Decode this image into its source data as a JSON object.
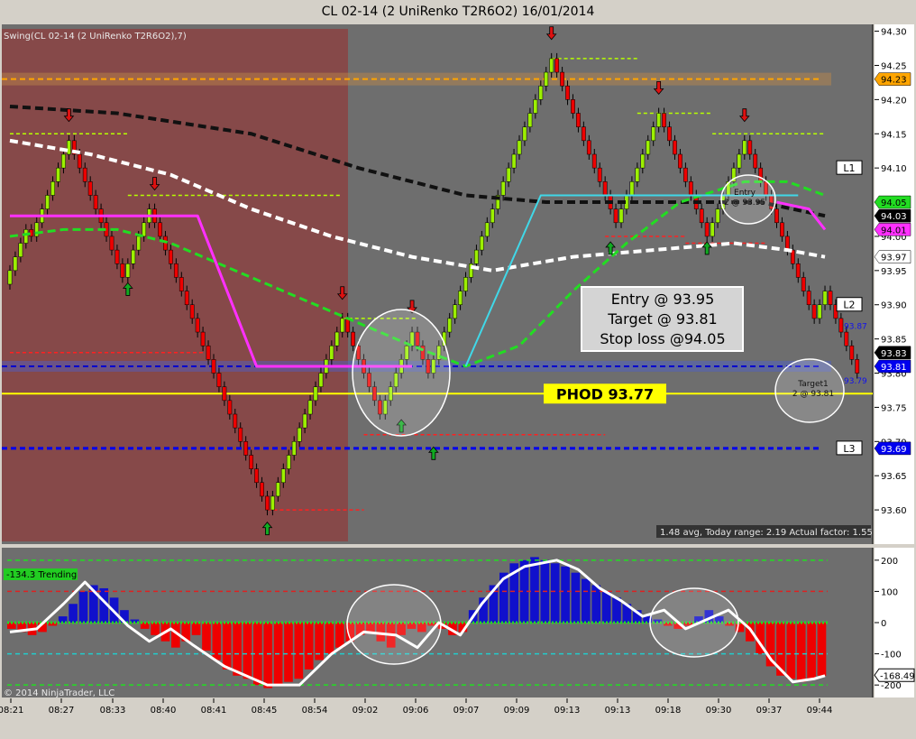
{
  "window": {
    "title": "CL 02-14 (2 UniRenko T2R6O2)  16/01/2014"
  },
  "colors": {
    "background": "#6e6e6e",
    "shaded_region": "#8b4343",
    "bull_bar": "#9cf000",
    "bear_bar": "#ee0000",
    "phod_line": "#ffff00",
    "bid_price": "#0000ff",
    "hist_positive": "#1010cc",
    "hist_negative": "#ee0000"
  },
  "chart_data": [
    {
      "type": "candlestick",
      "name": "price",
      "indicator_label": "Swing(CL 02-14 (2 UniRenko T2R6O2),7)",
      "ylim": [
        93.55,
        94.31
      ],
      "y_ticks": [
        "94.30",
        "94.25",
        "94.20",
        "94.15",
        "94.10",
        "94.05",
        "94.00",
        "93.95",
        "93.90",
        "93.85",
        "93.80",
        "93.75",
        "93.70",
        "93.65",
        "93.60"
      ],
      "x_ticks": [
        "08:21",
        "08:27",
        "08:33",
        "08:40",
        "08:41",
        "08:45",
        "08:54",
        "09:02",
        "09:06",
        "09:07",
        "09:09",
        "09:13",
        "09:13",
        "09:18",
        "09:30",
        "09:37",
        "09:44"
      ],
      "bars_closes": [
        93.95,
        93.97,
        93.99,
        94.01,
        94.0,
        94.02,
        94.04,
        94.06,
        94.08,
        94.1,
        94.12,
        94.14,
        94.12,
        94.1,
        94.08,
        94.06,
        94.04,
        94.02,
        94.0,
        93.98,
        93.96,
        93.94,
        93.96,
        93.98,
        94.0,
        94.02,
        94.04,
        94.02,
        94.0,
        93.98,
        93.96,
        93.94,
        93.92,
        93.9,
        93.88,
        93.86,
        93.84,
        93.82,
        93.8,
        93.78,
        93.76,
        93.74,
        93.72,
        93.7,
        93.68,
        93.66,
        93.64,
        93.62,
        93.6,
        93.62,
        93.64,
        93.66,
        93.68,
        93.7,
        93.72,
        93.74,
        93.76,
        93.78,
        93.8,
        93.82,
        93.84,
        93.86,
        93.88,
        93.86,
        93.84,
        93.82,
        93.8,
        93.78,
        93.76,
        93.74,
        93.76,
        93.78,
        93.8,
        93.82,
        93.84,
        93.86,
        93.84,
        93.82,
        93.8,
        93.82,
        93.84,
        93.86,
        93.88,
        93.9,
        93.92,
        93.94,
        93.96,
        93.98,
        94.0,
        94.02,
        94.04,
        94.06,
        94.08,
        94.1,
        94.12,
        94.14,
        94.16,
        94.18,
        94.2,
        94.22,
        94.24,
        94.26,
        94.24,
        94.22,
        94.2,
        94.18,
        94.16,
        94.14,
        94.12,
        94.1,
        94.08,
        94.06,
        94.04,
        94.02,
        94.04,
        94.06,
        94.08,
        94.1,
        94.12,
        94.14,
        94.16,
        94.18,
        94.16,
        94.14,
        94.12,
        94.1,
        94.08,
        94.06,
        94.04,
        94.02,
        94.0,
        94.02,
        94.04,
        94.06,
        94.08,
        94.1,
        94.12,
        94.14,
        94.12,
        94.1,
        94.08,
        94.06,
        94.04,
        94.02,
        94.0,
        93.98,
        93.96,
        93.94,
        93.92,
        93.9,
        93.88,
        93.9,
        93.92,
        93.9,
        93.88,
        93.86,
        93.84,
        93.82,
        93.8
      ],
      "box_size": 0.02,
      "swing_high_arrows": [
        {
          "bar": 11,
          "price": 94.16
        },
        {
          "bar": 27,
          "price": 94.06
        },
        {
          "bar": 62,
          "price": 93.9
        },
        {
          "bar": 75,
          "price": 93.88
        },
        {
          "bar": 101,
          "price": 94.28
        },
        {
          "bar": 121,
          "price": 94.2
        },
        {
          "bar": 137,
          "price": 94.16
        }
      ],
      "swing_low_arrows": [
        {
          "bar": 22,
          "price": 93.94
        },
        {
          "bar": 48,
          "price": 93.59
        },
        {
          "bar": 73,
          "price": 93.74
        },
        {
          "bar": 79,
          "price": 93.7
        },
        {
          "bar": 112,
          "price": 94.0
        },
        {
          "bar": 130,
          "price": 94.0
        }
      ],
      "dashed_levels": [
        {
          "price": 94.15,
          "from_bar": 0,
          "to_bar": 22,
          "color": "#b6ff00"
        },
        {
          "price": 94.06,
          "from_bar": 22,
          "to_bar": 62,
          "color": "#b6ff00"
        },
        {
          "price": 93.88,
          "from_bar": 62,
          "to_bar": 76,
          "color": "#b6ff00"
        },
        {
          "price": 94.26,
          "from_bar": 101,
          "to_bar": 117,
          "color": "#b6ff00"
        },
        {
          "price": 94.18,
          "from_bar": 117,
          "to_bar": 131,
          "color": "#b6ff00"
        },
        {
          "price": 94.15,
          "from_bar": 131,
          "to_bar": 152,
          "color": "#b6ff00"
        },
        {
          "price": 93.83,
          "from_bar": 0,
          "to_bar": 36,
          "color": "#ff2020"
        },
        {
          "price": 93.6,
          "from_bar": 48,
          "to_bar": 66,
          "color": "#ff2020"
        },
        {
          "price": 93.71,
          "from_bar": 66,
          "to_bar": 111,
          "color": "#ff2020"
        },
        {
          "price": 94.0,
          "from_bar": 111,
          "to_bar": 126,
          "color": "#ff2020"
        },
        {
          "price": 93.99,
          "from_bar": 126,
          "to_bar": 141,
          "color": "#ff2020"
        }
      ],
      "moving_averages": [
        {
          "color": "#111111",
          "style": "dash",
          "width": 4,
          "values": [
            [
              0,
              94.19
            ],
            [
              20,
              94.18
            ],
            [
              45,
              94.15
            ],
            [
              65,
              94.1
            ],
            [
              85,
              94.06
            ],
            [
              100,
              94.05
            ],
            [
              120,
              94.05
            ],
            [
              140,
              94.05
            ],
            [
              152,
              94.03
            ]
          ]
        },
        {
          "color": "#ffffff",
          "style": "dash",
          "width": 4,
          "values": [
            [
              0,
              94.14
            ],
            [
              15,
              94.12
            ],
            [
              30,
              94.09
            ],
            [
              45,
              94.04
            ],
            [
              60,
              94.0
            ],
            [
              75,
              93.97
            ],
            [
              90,
              93.95
            ],
            [
              105,
              93.97
            ],
            [
              120,
              93.98
            ],
            [
              135,
              93.99
            ],
            [
              145,
              93.98
            ],
            [
              152,
              93.97
            ]
          ]
        },
        {
          "color": "#22dd22",
          "style": "dash",
          "width": 3,
          "values": [
            [
              0,
              94.0
            ],
            [
              10,
              94.01
            ],
            [
              20,
              94.01
            ],
            [
              30,
              93.99
            ],
            [
              45,
              93.94
            ],
            [
              60,
              93.89
            ],
            [
              75,
              93.84
            ],
            [
              85,
              93.81
            ],
            [
              95,
              93.84
            ],
            [
              105,
              93.92
            ],
            [
              115,
              93.99
            ],
            [
              125,
              94.05
            ],
            [
              137,
              94.08
            ],
            [
              145,
              94.08
            ],
            [
              152,
              94.06
            ]
          ]
        },
        {
          "color": "#ff30ff",
          "style": "solid",
          "width": 3,
          "values": [
            [
              0,
              94.03
            ],
            [
              35,
              94.03
            ],
            [
              46,
              93.81
            ],
            [
              60,
              93.81
            ],
            [
              75,
              93.81
            ]
          ]
        },
        {
          "color": "#ff30ff",
          "style": "solid",
          "width": 3,
          "values": [
            [
              143,
              94.05
            ],
            [
              149,
              94.04
            ],
            [
              152,
              94.01
            ]
          ]
        },
        {
          "color": "#40d8e8",
          "style": "solid",
          "width": 2,
          "values": [
            [
              85,
              93.81
            ],
            [
              99,
              94.06
            ],
            [
              147,
              94.06
            ]
          ]
        }
      ],
      "horizontal_lines": [
        {
          "label": "PHOD  93.77",
          "price": 93.77,
          "color": "#ffff00",
          "style": "solid"
        },
        {
          "price": 93.69,
          "color": "#0000ee",
          "style": "dash"
        },
        {
          "price": 94.23,
          "color": "#ffa500",
          "style": "dash"
        },
        {
          "price": 93.81,
          "color": "#0000cc",
          "style": "dash"
        }
      ],
      "level_labels": [
        {
          "label": "L1",
          "price": 94.1
        },
        {
          "label": "L2",
          "price": 93.9
        },
        {
          "label": "L3",
          "price": 93.69
        }
      ],
      "price_markers": [
        {
          "text": "94.23",
          "price": 94.23,
          "bg": "#ffa500",
          "fg": "#000000"
        },
        {
          "text": "94.05",
          "price": 94.05,
          "bg": "#22dd22",
          "fg": "#000000"
        },
        {
          "text": "94.03",
          "price": 94.03,
          "bg": "#000000",
          "fg": "#ffffff"
        },
        {
          "text": "94.01",
          "price": 94.01,
          "bg": "#ff30ff",
          "fg": "#000000"
        },
        {
          "text": "93.97",
          "price": 93.97,
          "bg": "#ffffff",
          "fg": "#000000"
        },
        {
          "text": "93.83",
          "price": 93.83,
          "bg": "#000000",
          "fg": "#ffffff"
        },
        {
          "text": "93.81",
          "price": 93.81,
          "bg": "#0000ee",
          "fg": "#ffffff"
        },
        {
          "text": "93.69",
          "price": 93.69,
          "bg": "#0000ee",
          "fg": "#ffffff"
        }
      ],
      "annotations": {
        "trade_box": [
          "Entry @ 93.95",
          "Target @ 93.81",
          "Stop loss @94.05"
        ],
        "entry_marker": [
          "Entry",
          "2 @ 93.95"
        ],
        "target_marker": [
          "Target1",
          "2 @ 93.81"
        ],
        "level_93_87": "93.87",
        "level_93_79": "93.79",
        "status_text": "1.48 avg, Today range: 2.19  Actual factor: 1.55"
      }
    },
    {
      "type": "oscillator",
      "name": "cci",
      "label": "-134.3 Trending",
      "ylim": [
        -240,
        240
      ],
      "y_ticks": [
        "200",
        "100",
        "0",
        "-100",
        "-200"
      ],
      "last_value": "-168.49",
      "levels": [
        {
          "value": 200,
          "color": "#22dd22"
        },
        {
          "value": 100,
          "color": "#dd2222"
        },
        {
          "value": -100,
          "color": "#22cccc"
        },
        {
          "value": -200,
          "color": "#22dd22"
        }
      ],
      "line": [
        [
          0,
          -30
        ],
        [
          5,
          -20
        ],
        [
          10,
          60
        ],
        [
          14,
          130
        ],
        [
          18,
          60
        ],
        [
          22,
          -10
        ],
        [
          26,
          -60
        ],
        [
          30,
          -20
        ],
        [
          34,
          -70
        ],
        [
          40,
          -140
        ],
        [
          48,
          -200
        ],
        [
          54,
          -200
        ],
        [
          60,
          -100
        ],
        [
          66,
          -30
        ],
        [
          72,
          -40
        ],
        [
          76,
          -80
        ],
        [
          80,
          0
        ],
        [
          84,
          -40
        ],
        [
          88,
          60
        ],
        [
          92,
          140
        ],
        [
          96,
          180
        ],
        [
          102,
          200
        ],
        [
          106,
          170
        ],
        [
          110,
          110
        ],
        [
          114,
          70
        ],
        [
          118,
          20
        ],
        [
          122,
          40
        ],
        [
          126,
          -20
        ],
        [
          130,
          10
        ],
        [
          134,
          40
        ],
        [
          138,
          -20
        ],
        [
          142,
          -120
        ],
        [
          146,
          -190
        ],
        [
          150,
          -180
        ],
        [
          152,
          -170
        ]
      ],
      "histogram": [
        -20,
        -30,
        -40,
        -30,
        -10,
        20,
        60,
        100,
        120,
        110,
        80,
        40,
        10,
        -20,
        -40,
        -60,
        -80,
        -60,
        -40,
        -90,
        -120,
        -150,
        -170,
        -180,
        -200,
        -210,
        -200,
        -190,
        -180,
        -150,
        -120,
        -100,
        -80,
        -60,
        -40,
        -30,
        -60,
        -80,
        -40,
        -20,
        -30,
        -10,
        -20,
        -40,
        -30,
        40,
        80,
        120,
        160,
        190,
        200,
        210,
        200,
        190,
        180,
        160,
        140,
        120,
        100,
        80,
        60,
        40,
        20,
        10,
        -10,
        -20,
        -10,
        20,
        40,
        20,
        -10,
        -30,
        -60,
        -100,
        -140,
        -170,
        -180,
        -190,
        -180,
        -170
      ]
    }
  ],
  "footer": {
    "copyright": "© 2014 NinjaTrader, LLC"
  }
}
